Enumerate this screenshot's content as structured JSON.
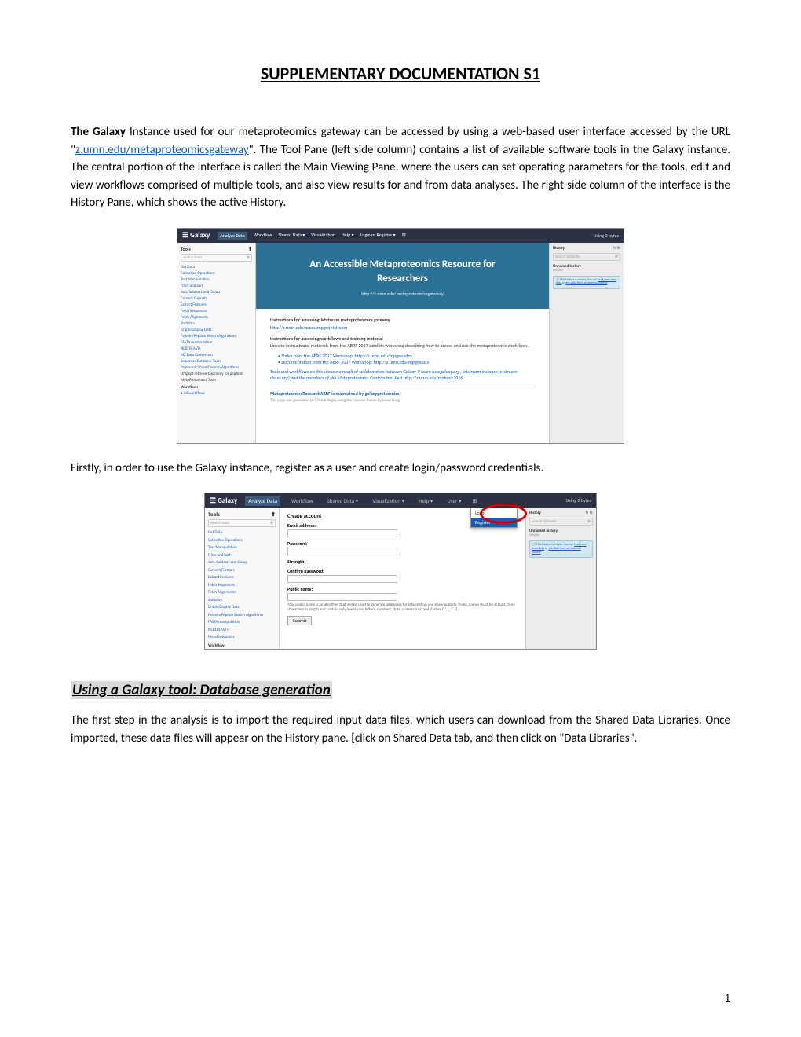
{
  "title": "SUPPLEMENTARY DOCUMENTATION S1",
  "para1_lead": "The Galaxy",
  "para1_a": " Instance used for our metaproteomics gateway can be accessed by using a web-based user interface accessed by the URL \"",
  "para1_link": "z.umn.edu/metaproteomicsgateway",
  "para1_b": "\". The Tool Pane (left side column) contains a list of available software tools in the Galaxy instance. The central portion of the interface is called the Main Viewing Pane, where the users can set operating parameters for the tools, edit and view workflows comprised of multiple tools, and also view results for and from data analyses. The right-side column of the interface is the History Pane, which shows the active History.",
  "para2": "Firstly, in order to use the Galaxy instance, register as a user and create login/password credentials.",
  "section_title": "Using a Galaxy tool: Database generation",
  "para3": "The first step in the analysis is to import the required input data files, which users can download from the Shared Data Libraries.  Once imported, these data files will appear on the History pane. [click on Shared Data tab, and then click on \"Data Libraries\".",
  "page_number": "1",
  "galaxy": {
    "logo": "☰ Galaxy",
    "nav": [
      "Analyze Data",
      "Workflow",
      "Shared Data ▾",
      "Visualization",
      "Help ▾",
      "Login or Register ▾"
    ],
    "nav_right": "Using 0 bytes",
    "tools_header": "Tools",
    "search_placeholder": "search tools",
    "tool_list": [
      "Get Data",
      "Collection Operations",
      "Text Manipulation",
      "Filter and Sort",
      "Join, Subtract and Group",
      "Convert Formats",
      "Extract Features",
      "Fetch Sequences",
      "Fetch Alignments",
      "Statistics",
      "Graph/Display Data",
      "Protein/Peptide Search Algorithms",
      "FASTA manipulation",
      "NCBI BLAST+",
      "MZ Data Conversion",
      "Sequence Database Tools",
      "Proteomic Shared Search Algorithms"
    ],
    "tool_sub": [
      "Unipept retrieve taxonomy for peptides",
      "MetaProteomics Tools"
    ],
    "workflows_label": "Workflows",
    "all_workflows": "• All workflows",
    "hero_line1": "An Accessible Metaproteomics Resource for",
    "hero_line2": "Researchers",
    "hero_url": "http://z.umn.edu/metaproteomicsgateway",
    "c1_h": "Instructions for accessing Jetstream metaproteomics gateway",
    "c1_link": "http://z.umn.edu/accessmpgwjetstream",
    "c2_h": "Instructions for accessing workflows and training material",
    "c2_p": "Links to instructional materials from the ABRF 2017 satellite workshop describing how to access and use the metaproteomic workflows.",
    "c2_li1": "• Slides from the ABRF 2017 Workshop: http://z.umn.edu/mpgwslides",
    "c2_li2": "• Documentation from the ABRF 2017 Workshop: http://z.umn.edu/mpgwdocs",
    "c3_p": "Tools and workflows on this site are a result of collaboration between Galaxy-P team (usegalaxy.org, Jetstream instance jetstream-cloud.org) and the members of the Metaproteomics Contribution Fest http://z.umn.edu/mphack2016.",
    "c4_h": "MetaproteomicsResearchABRF is maintained by galaxyproteomics",
    "c4_p": "This page was generated by GitHub Pages using the Cayman theme by Jason Long.",
    "history_label": "History",
    "history_name": "Unnamed history",
    "history_size": "(empty)",
    "history_info_lead": "ⓘ ",
    "history_info": "This history is empty. You can load your own data or get data from an external source",
    "history_link1": "load your own data",
    "history_link2": "get data from an external source"
  },
  "galaxy2": {
    "nav": [
      "Analyze Data",
      "Workflow",
      "Shared Data ▾",
      "Visualization ▾",
      "Help ▾",
      "User ▾"
    ],
    "dropdown": [
      "Login",
      "Register"
    ],
    "form_title": "Create account",
    "labels": [
      "Email address:",
      "Password:",
      "Strength:",
      "Confirm password:",
      "Public name:"
    ],
    "help": "Your public name is an identifier that will be used to generate addresses for information you share publicly. Public names must be at least three characters in length and contain only lower-case letters, numbers, dots, underscores, and dashes ('.', '_', '-').",
    "submit": "Submit",
    "tool_list": [
      "Get Data",
      "Collection Operations",
      "Text Manipulation",
      "Filter and Sort",
      "Join, Subtract and Group",
      "Convert Formats",
      "Extract Features",
      "Fetch Sequences",
      "Fetch Alignments",
      "Statistics",
      "Graph/Display Data",
      "Protein/Peptide Search Algorithms",
      "FASTA manipulation",
      "NCBI BLAST+",
      "MetaProteomics"
    ],
    "history_search": "search datasets",
    "history_name": "Unnamed history",
    "history_size": "(empty)",
    "history_info": "This history is empty. You can load your own data or get data from an external source"
  }
}
